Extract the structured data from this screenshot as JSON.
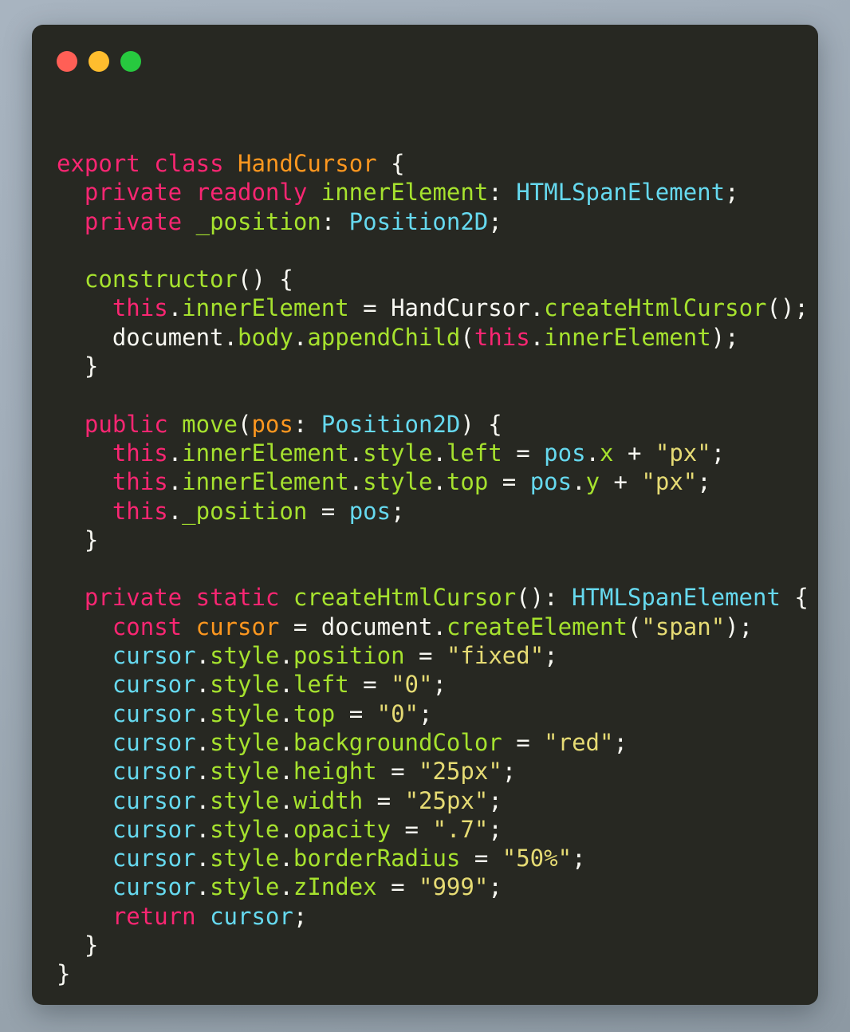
{
  "window": {
    "background_color": "#272822",
    "title": "",
    "controls": [
      {
        "name": "close",
        "color": "#ff5f56"
      },
      {
        "name": "minimize",
        "color": "#ffbd2e"
      },
      {
        "name": "maximize",
        "color": "#27c93f"
      }
    ]
  },
  "theme": {
    "page_background_from": "#a8b4c0",
    "page_background_to": "#8d99a3",
    "keyword": "#f92672",
    "type": "#66d9ef",
    "function": "#a6e22e",
    "class_name": "#fd971f",
    "string": "#e6db74",
    "plain": "#f8f8f2"
  },
  "code": {
    "language": "typescript",
    "plain_text": "export class HandCursor {\n  private readonly innerElement: HTMLSpanElement;\n  private _position: Position2D;\n\n  constructor() {\n    this.innerElement = HandCursor.createHtmlCursor();\n    document.body.appendChild(this.innerElement);\n  }\n\n  public move(pos: Position2D) {\n    this.innerElement.style.left = pos.x + \"px\";\n    this.innerElement.style.top = pos.y + \"px\";\n    this._position = pos;\n  }\n\n  private static createHtmlCursor(): HTMLSpanElement {\n    const cursor = document.createElement(\"span\");\n    cursor.style.position = \"fixed\";\n    cursor.style.left = \"0\";\n    cursor.style.top = \"0\";\n    cursor.style.backgroundColor = \"red\";\n    cursor.style.height = \"25px\";\n    cursor.style.width = \"25px\";\n    cursor.style.opacity = \".7\";\n    cursor.style.borderRadius = \"50%\";\n    cursor.style.zIndex = \"999\";\n    return cursor;\n  }\n}",
    "lines": [
      {
        "indent": 0,
        "tokens": [
          {
            "t": "export",
            "c": "kw"
          },
          {
            "t": " ",
            "c": "plain"
          },
          {
            "t": "class",
            "c": "kw"
          },
          {
            "t": " ",
            "c": "plain"
          },
          {
            "t": "HandCursor",
            "c": "cls"
          },
          {
            "t": " {",
            "c": "plain"
          }
        ]
      },
      {
        "indent": 1,
        "tokens": [
          {
            "t": "private",
            "c": "kw"
          },
          {
            "t": " ",
            "c": "plain"
          },
          {
            "t": "readonly",
            "c": "kw"
          },
          {
            "t": " ",
            "c": "plain"
          },
          {
            "t": "innerElement",
            "c": "fn"
          },
          {
            "t": ": ",
            "c": "plain"
          },
          {
            "t": "HTMLSpanElement",
            "c": "type"
          },
          {
            "t": ";",
            "c": "plain"
          }
        ]
      },
      {
        "indent": 1,
        "tokens": [
          {
            "t": "private",
            "c": "kw"
          },
          {
            "t": " ",
            "c": "plain"
          },
          {
            "t": "_position",
            "c": "fn"
          },
          {
            "t": ": ",
            "c": "plain"
          },
          {
            "t": "Position2D",
            "c": "type"
          },
          {
            "t": ";",
            "c": "plain"
          }
        ]
      },
      {
        "indent": 0,
        "tokens": []
      },
      {
        "indent": 1,
        "tokens": [
          {
            "t": "constructor",
            "c": "fn"
          },
          {
            "t": "() {",
            "c": "plain"
          }
        ]
      },
      {
        "indent": 2,
        "tokens": [
          {
            "t": "this",
            "c": "kw"
          },
          {
            "t": ".",
            "c": "plain"
          },
          {
            "t": "innerElement",
            "c": "fn"
          },
          {
            "t": " = ",
            "c": "plain"
          },
          {
            "t": "HandCursor",
            "c": "plain"
          },
          {
            "t": ".",
            "c": "plain"
          },
          {
            "t": "createHtmlCursor",
            "c": "fn"
          },
          {
            "t": "();",
            "c": "plain"
          }
        ]
      },
      {
        "indent": 2,
        "tokens": [
          {
            "t": "document",
            "c": "plain"
          },
          {
            "t": ".",
            "c": "plain"
          },
          {
            "t": "body",
            "c": "fn"
          },
          {
            "t": ".",
            "c": "plain"
          },
          {
            "t": "appendChild",
            "c": "fn"
          },
          {
            "t": "(",
            "c": "plain"
          },
          {
            "t": "this",
            "c": "kw"
          },
          {
            "t": ".",
            "c": "plain"
          },
          {
            "t": "innerElement",
            "c": "fn"
          },
          {
            "t": ");",
            "c": "plain"
          }
        ]
      },
      {
        "indent": 1,
        "tokens": [
          {
            "t": "}",
            "c": "plain"
          }
        ]
      },
      {
        "indent": 0,
        "tokens": []
      },
      {
        "indent": 1,
        "tokens": [
          {
            "t": "public",
            "c": "kw"
          },
          {
            "t": " ",
            "c": "plain"
          },
          {
            "t": "move",
            "c": "fn"
          },
          {
            "t": "(",
            "c": "plain"
          },
          {
            "t": "pos",
            "c": "cls"
          },
          {
            "t": ": ",
            "c": "plain"
          },
          {
            "t": "Position2D",
            "c": "type"
          },
          {
            "t": ") {",
            "c": "plain"
          }
        ]
      },
      {
        "indent": 2,
        "tokens": [
          {
            "t": "this",
            "c": "kw"
          },
          {
            "t": ".",
            "c": "plain"
          },
          {
            "t": "innerElement",
            "c": "fn"
          },
          {
            "t": ".",
            "c": "plain"
          },
          {
            "t": "style",
            "c": "fn"
          },
          {
            "t": ".",
            "c": "plain"
          },
          {
            "t": "left",
            "c": "fn"
          },
          {
            "t": " = ",
            "c": "plain"
          },
          {
            "t": "pos",
            "c": "type"
          },
          {
            "t": ".",
            "c": "plain"
          },
          {
            "t": "x",
            "c": "fn"
          },
          {
            "t": " + ",
            "c": "plain"
          },
          {
            "t": "\"px\"",
            "c": "str"
          },
          {
            "t": ";",
            "c": "plain"
          }
        ]
      },
      {
        "indent": 2,
        "tokens": [
          {
            "t": "this",
            "c": "kw"
          },
          {
            "t": ".",
            "c": "plain"
          },
          {
            "t": "innerElement",
            "c": "fn"
          },
          {
            "t": ".",
            "c": "plain"
          },
          {
            "t": "style",
            "c": "fn"
          },
          {
            "t": ".",
            "c": "plain"
          },
          {
            "t": "top",
            "c": "fn"
          },
          {
            "t": " = ",
            "c": "plain"
          },
          {
            "t": "pos",
            "c": "type"
          },
          {
            "t": ".",
            "c": "plain"
          },
          {
            "t": "y",
            "c": "fn"
          },
          {
            "t": " + ",
            "c": "plain"
          },
          {
            "t": "\"px\"",
            "c": "str"
          },
          {
            "t": ";",
            "c": "plain"
          }
        ]
      },
      {
        "indent": 2,
        "tokens": [
          {
            "t": "this",
            "c": "kw"
          },
          {
            "t": ".",
            "c": "plain"
          },
          {
            "t": "_position",
            "c": "fn"
          },
          {
            "t": " = ",
            "c": "plain"
          },
          {
            "t": "pos",
            "c": "type"
          },
          {
            "t": ";",
            "c": "plain"
          }
        ]
      },
      {
        "indent": 1,
        "tokens": [
          {
            "t": "}",
            "c": "plain"
          }
        ]
      },
      {
        "indent": 0,
        "tokens": []
      },
      {
        "indent": 1,
        "tokens": [
          {
            "t": "private",
            "c": "kw"
          },
          {
            "t": " ",
            "c": "plain"
          },
          {
            "t": "static",
            "c": "kw"
          },
          {
            "t": " ",
            "c": "plain"
          },
          {
            "t": "createHtmlCursor",
            "c": "fn"
          },
          {
            "t": "(): ",
            "c": "plain"
          },
          {
            "t": "HTMLSpanElement",
            "c": "type"
          },
          {
            "t": " {",
            "c": "plain"
          }
        ]
      },
      {
        "indent": 2,
        "tokens": [
          {
            "t": "const",
            "c": "kw"
          },
          {
            "t": " ",
            "c": "plain"
          },
          {
            "t": "cursor",
            "c": "cls"
          },
          {
            "t": " = ",
            "c": "plain"
          },
          {
            "t": "document",
            "c": "plain"
          },
          {
            "t": ".",
            "c": "plain"
          },
          {
            "t": "createElement",
            "c": "fn"
          },
          {
            "t": "(",
            "c": "plain"
          },
          {
            "t": "\"span\"",
            "c": "str"
          },
          {
            "t": ");",
            "c": "plain"
          }
        ]
      },
      {
        "indent": 2,
        "tokens": [
          {
            "t": "cursor",
            "c": "type"
          },
          {
            "t": ".",
            "c": "plain"
          },
          {
            "t": "style",
            "c": "fn"
          },
          {
            "t": ".",
            "c": "plain"
          },
          {
            "t": "position",
            "c": "fn"
          },
          {
            "t": " = ",
            "c": "plain"
          },
          {
            "t": "\"fixed\"",
            "c": "str"
          },
          {
            "t": ";",
            "c": "plain"
          }
        ]
      },
      {
        "indent": 2,
        "tokens": [
          {
            "t": "cursor",
            "c": "type"
          },
          {
            "t": ".",
            "c": "plain"
          },
          {
            "t": "style",
            "c": "fn"
          },
          {
            "t": ".",
            "c": "plain"
          },
          {
            "t": "left",
            "c": "fn"
          },
          {
            "t": " = ",
            "c": "plain"
          },
          {
            "t": "\"0\"",
            "c": "str"
          },
          {
            "t": ";",
            "c": "plain"
          }
        ]
      },
      {
        "indent": 2,
        "tokens": [
          {
            "t": "cursor",
            "c": "type"
          },
          {
            "t": ".",
            "c": "plain"
          },
          {
            "t": "style",
            "c": "fn"
          },
          {
            "t": ".",
            "c": "plain"
          },
          {
            "t": "top",
            "c": "fn"
          },
          {
            "t": " = ",
            "c": "plain"
          },
          {
            "t": "\"0\"",
            "c": "str"
          },
          {
            "t": ";",
            "c": "plain"
          }
        ]
      },
      {
        "indent": 2,
        "tokens": [
          {
            "t": "cursor",
            "c": "type"
          },
          {
            "t": ".",
            "c": "plain"
          },
          {
            "t": "style",
            "c": "fn"
          },
          {
            "t": ".",
            "c": "plain"
          },
          {
            "t": "backgroundColor",
            "c": "fn"
          },
          {
            "t": " = ",
            "c": "plain"
          },
          {
            "t": "\"red\"",
            "c": "str"
          },
          {
            "t": ";",
            "c": "plain"
          }
        ]
      },
      {
        "indent": 2,
        "tokens": [
          {
            "t": "cursor",
            "c": "type"
          },
          {
            "t": ".",
            "c": "plain"
          },
          {
            "t": "style",
            "c": "fn"
          },
          {
            "t": ".",
            "c": "plain"
          },
          {
            "t": "height",
            "c": "fn"
          },
          {
            "t": " = ",
            "c": "plain"
          },
          {
            "t": "\"25px\"",
            "c": "str"
          },
          {
            "t": ";",
            "c": "plain"
          }
        ]
      },
      {
        "indent": 2,
        "tokens": [
          {
            "t": "cursor",
            "c": "type"
          },
          {
            "t": ".",
            "c": "plain"
          },
          {
            "t": "style",
            "c": "fn"
          },
          {
            "t": ".",
            "c": "plain"
          },
          {
            "t": "width",
            "c": "fn"
          },
          {
            "t": " = ",
            "c": "plain"
          },
          {
            "t": "\"25px\"",
            "c": "str"
          },
          {
            "t": ";",
            "c": "plain"
          }
        ]
      },
      {
        "indent": 2,
        "tokens": [
          {
            "t": "cursor",
            "c": "type"
          },
          {
            "t": ".",
            "c": "plain"
          },
          {
            "t": "style",
            "c": "fn"
          },
          {
            "t": ".",
            "c": "plain"
          },
          {
            "t": "opacity",
            "c": "fn"
          },
          {
            "t": " = ",
            "c": "plain"
          },
          {
            "t": "\".7\"",
            "c": "str"
          },
          {
            "t": ";",
            "c": "plain"
          }
        ]
      },
      {
        "indent": 2,
        "tokens": [
          {
            "t": "cursor",
            "c": "type"
          },
          {
            "t": ".",
            "c": "plain"
          },
          {
            "t": "style",
            "c": "fn"
          },
          {
            "t": ".",
            "c": "plain"
          },
          {
            "t": "borderRadius",
            "c": "fn"
          },
          {
            "t": " = ",
            "c": "plain"
          },
          {
            "t": "\"50%\"",
            "c": "str"
          },
          {
            "t": ";",
            "c": "plain"
          }
        ]
      },
      {
        "indent": 2,
        "tokens": [
          {
            "t": "cursor",
            "c": "type"
          },
          {
            "t": ".",
            "c": "plain"
          },
          {
            "t": "style",
            "c": "fn"
          },
          {
            "t": ".",
            "c": "plain"
          },
          {
            "t": "zIndex",
            "c": "fn"
          },
          {
            "t": " = ",
            "c": "plain"
          },
          {
            "t": "\"999\"",
            "c": "str"
          },
          {
            "t": ";",
            "c": "plain"
          }
        ]
      },
      {
        "indent": 2,
        "tokens": [
          {
            "t": "return",
            "c": "kw"
          },
          {
            "t": " ",
            "c": "plain"
          },
          {
            "t": "cursor",
            "c": "type"
          },
          {
            "t": ";",
            "c": "plain"
          }
        ]
      },
      {
        "indent": 1,
        "tokens": [
          {
            "t": "}",
            "c": "plain"
          }
        ]
      },
      {
        "indent": 0,
        "tokens": [
          {
            "t": "}",
            "c": "plain"
          }
        ]
      }
    ]
  }
}
